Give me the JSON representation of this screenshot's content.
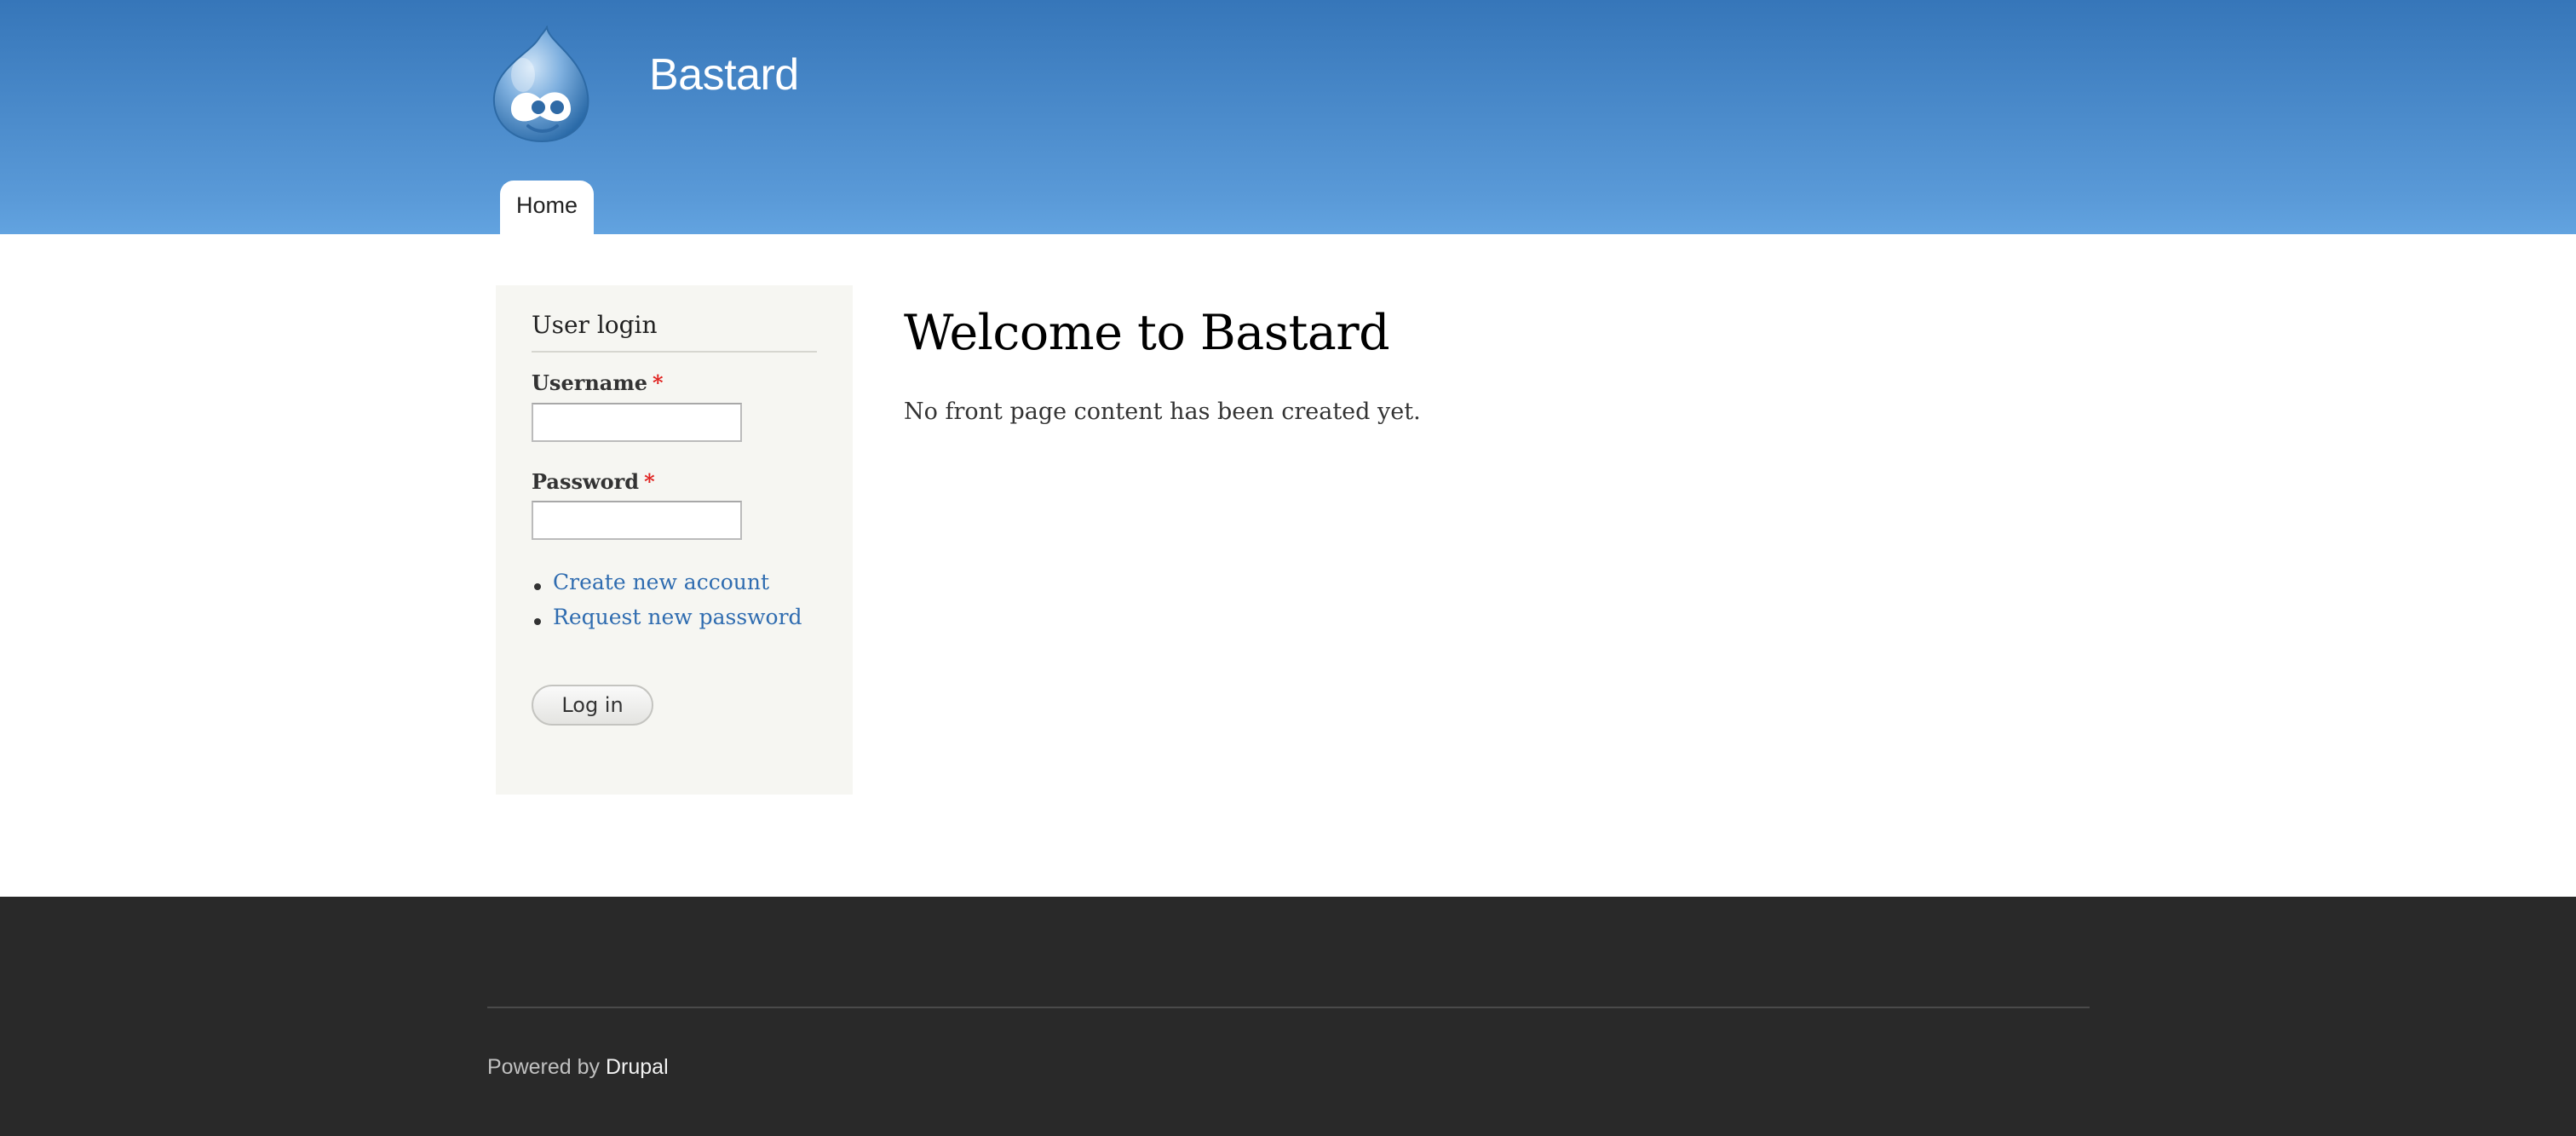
{
  "header": {
    "site_name": "Bastard",
    "logo_icon": "drupal-drop-icon",
    "nav": [
      {
        "label": "Home",
        "active": true
      }
    ]
  },
  "sidebar": {
    "login_block": {
      "title": "User login",
      "username_label": "Username",
      "username_value": "",
      "password_label": "Password",
      "password_value": "",
      "required_marker": "*",
      "links": [
        {
          "label": "Create new account"
        },
        {
          "label": "Request new password"
        }
      ],
      "submit_label": "Log in"
    }
  },
  "main": {
    "title": "Welcome to Bastard",
    "text": "No front page content has been created yet."
  },
  "footer": {
    "powered_by": "Powered by",
    "link_label": "Drupal"
  },
  "colors": {
    "header_gradient_top": "#3676b9",
    "header_gradient_bottom": "#62a3e0",
    "link": "#2f6cb0",
    "required": "#e0201e",
    "sidebar_bg": "#f6f6f2",
    "footer_bg": "#292929"
  }
}
